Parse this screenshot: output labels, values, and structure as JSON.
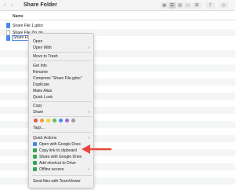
{
  "toolbar": {
    "back_icon": "chevron-left-icon",
    "forward_icon": "chevron-right-icon",
    "title": "Share Folder",
    "view_modes": [
      "icon-view",
      "list-view",
      "column-view",
      "gallery-view"
    ],
    "active_view": "list-view"
  },
  "columns": {
    "name": "Name"
  },
  "files": [
    {
      "name": "Share File 1.gdoc",
      "icon": "google-doc-icon"
    },
    {
      "name": "Share File Zip.zip",
      "icon": "zip-file-icon"
    },
    {
      "name": "Share File...",
      "icon": "google-doc-icon",
      "renaming": true
    }
  ],
  "context_menu": {
    "open": "Open",
    "open_with": "Open With",
    "move_to_trash": "Move to Trash",
    "get_info": "Get Info",
    "rename": "Rename",
    "compress": "Compress “Share File.gdoc”",
    "duplicate": "Duplicate",
    "make_alias": "Make Alias",
    "quick_look": "Quick Look",
    "copy": "Copy",
    "share": "Share",
    "tags": "Tags...",
    "tag_colors": [
      "#e8534a",
      "#f29c38",
      "#f2cf3b",
      "#5cbf5a",
      "#4b8de6",
      "#9f6ad8",
      "#9b9b9b"
    ],
    "quick_actions": "Quick Actions",
    "open_with_google_docs": "Open with Google Docs",
    "copy_link_to_clipboard": "Copy link to clipboard",
    "share_with_google_drive": "Share with Google Drive",
    "add_shortcut_to_drive": "Add shortcut to Drive",
    "offline_access": "Offline access",
    "send_files_teamviewer": "Send files with TeamViewer"
  },
  "annotation": {
    "arrow_color": "#e8473a"
  }
}
